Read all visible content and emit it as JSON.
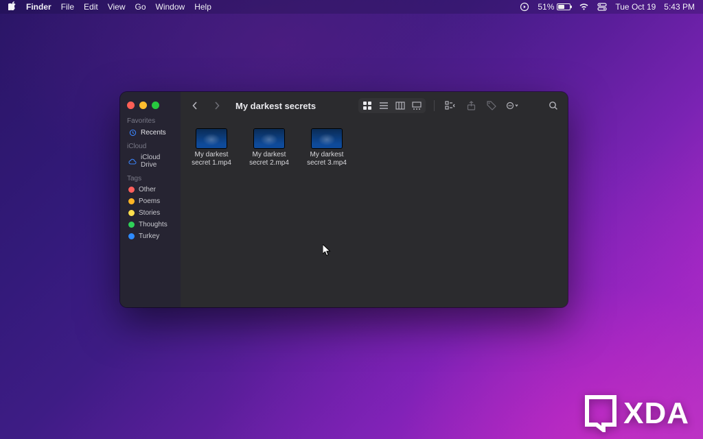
{
  "menubar": {
    "app": "Finder",
    "items": [
      "File",
      "Edit",
      "View",
      "Go",
      "Window",
      "Help"
    ],
    "status": {
      "battery_pct": "51%",
      "date": "Tue Oct 19",
      "time": "5:43 PM"
    }
  },
  "finder": {
    "title": "My darkest secrets",
    "sidebar": {
      "sections": [
        {
          "heading": "Favorites",
          "items": [
            {
              "label": "Recents",
              "icon": "clock-icon",
              "active": true
            }
          ]
        },
        {
          "heading": "iCloud",
          "items": [
            {
              "label": "iCloud Drive",
              "icon": "cloud-icon"
            }
          ]
        },
        {
          "heading": "Tags",
          "items": [
            {
              "label": "Other",
              "color": "#ff605c"
            },
            {
              "label": "Poems",
              "color": "#ffb524"
            },
            {
              "label": "Stories",
              "color": "#ffe04d"
            },
            {
              "label": "Thoughts",
              "color": "#2fd158"
            },
            {
              "label": "Turkey",
              "color": "#2e8bff"
            }
          ]
        }
      ]
    },
    "files": [
      {
        "name": "My darkest secret 1.mp4"
      },
      {
        "name": "My darkest secret 2.mp4"
      },
      {
        "name": "My darkest secret 3.mp4"
      }
    ]
  },
  "watermark": {
    "text": "XDA"
  }
}
